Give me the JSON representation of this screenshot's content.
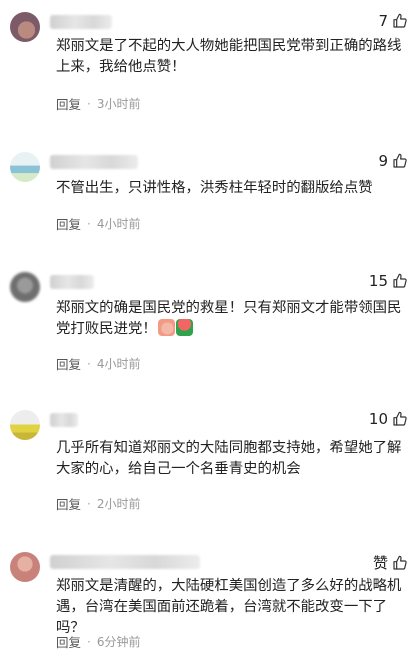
{
  "comments": [
    {
      "likes_label": "7",
      "text": "郑丽文是了不起的大人物她能把国民党带到正确的路线上来，我给他点赞！",
      "reply_label": "回复",
      "time": "3小时前"
    },
    {
      "likes_label": "9",
      "text": "不管出生，只讲性格，洪秀柱年轻时的翻版给点赞",
      "reply_label": "回复",
      "time": "4小时前"
    },
    {
      "likes_label": "15",
      "text": "郑丽文的确是国民党的救星！只有郑丽文才能带领国民党打败民进党！",
      "reply_label": "回复",
      "time": "4小时前"
    },
    {
      "likes_label": "10",
      "text": "几乎所有知道郑丽文的大陆同胞都支持她，希望她了解大家的心，给自己一个名垂青史的机会",
      "reply_label": "回复",
      "time": "2小时前"
    },
    {
      "likes_label": "赞",
      "text": "郑丽文是清醒的，大陆硬杠美国创造了多么好的战略机遇，台湾在美国面前还跪着，台湾就不能改变一下了吗？",
      "reply_label": "回复",
      "time": "6分钟前"
    }
  ],
  "separator": "·",
  "icons": {
    "like": "thumbs-up-icon"
  }
}
